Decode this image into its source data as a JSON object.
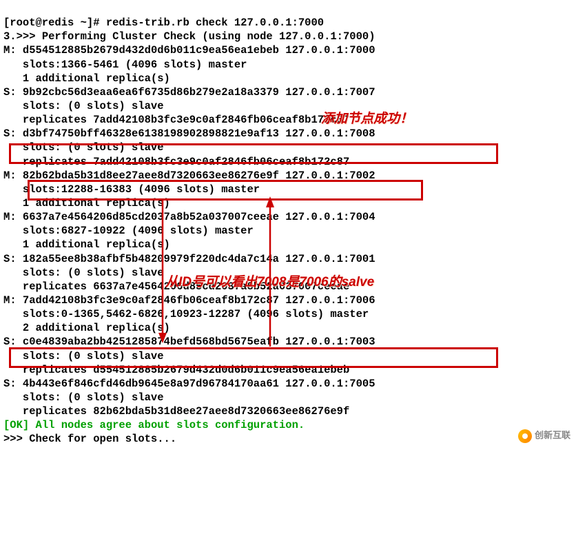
{
  "terminal": {
    "prompt": "[root@redis ~]# ",
    "command": "redis-trib.rb check 127.0.0.1:7000",
    "line_prefix": "3.",
    "header": ">>> Performing Cluster Check (using node 127.0.0.1:7000)",
    "nodes": [
      {
        "role": "M",
        "id": "d554512885b2679d432d0d6b011c9ea56ea1ebeb",
        "addr": "127.0.0.1:7000",
        "slots": "slots:1366-5461 (4096 slots) master",
        "extra": "1 additional replica(s)"
      },
      {
        "role": "S",
        "id": "9b92cbc56d3eaa6ea6f6735d86b279e2a18a3379",
        "addr": "127.0.0.1:7007",
        "slots": "slots: (0 slots) slave",
        "extra": "replicates 7add42108b3fc3e9c0af2846fb06ceaf8b172c87"
      },
      {
        "role": "S",
        "id": "d3bf74750bff46328e6138198902898821e9af13",
        "addr": "127.0.0.1:7008",
        "slots": "slots: (0 slots) slave",
        "extra": "replicates 7add42108b3fc3e9c0af2846fb06ceaf8b172c87"
      },
      {
        "role": "M",
        "id": "82b62bda5b31d8ee27aee8d7320663ee86276e9f",
        "addr": "127.0.0.1:7002",
        "slots": "slots:12288-16383 (4096 slots) master",
        "extra": "1 additional replica(s)"
      },
      {
        "role": "M",
        "id": "6637a7e4564206d85cd2037a8b52a037007ceeae",
        "addr": "127.0.0.1:7004",
        "slots": "slots:6827-10922 (4096 slots) master",
        "extra": "1 additional replica(s)"
      },
      {
        "role": "S",
        "id": "182a55ee8b38afbf5b48209979f220dc4da7c14a",
        "addr": "127.0.0.1:7001",
        "slots": "slots: (0 slots) slave",
        "extra": "replicates 6637a7e4564206d85cd2037a8b52a037007ceeae"
      },
      {
        "role": "M",
        "id": "7add42108b3fc3e9c0af2846fb06ceaf8b172c87",
        "addr": "127.0.0.1:7006",
        "slots": "slots:0-1365,5462-6826,10923-12287 (4096 slots) master",
        "extra": "2 additional replica(s)"
      },
      {
        "role": "S",
        "id": "c0e4839aba2bb4251285874befd568bd5675eafb",
        "addr": "127.0.0.1:7003",
        "slots": "slots: (0 slots) slave",
        "extra": "replicates d554512885b2679d432d0d6b011c9ea56ea1ebeb"
      },
      {
        "role": "S",
        "id": "4b443e6f846cfd46db9645e8a97d96784170aa61",
        "addr": "127.0.0.1:7005",
        "slots": "slots: (0 slots) slave",
        "extra": "replicates 82b62bda5b31d8ee27aee8d7320663ee86276e9f"
      }
    ],
    "ok_prefix": "[OK] ",
    "ok_text": "All nodes agree about slots configuration.",
    "check_slots": ">>> Check for open slots..."
  },
  "annotations": {
    "ann1": "添加节点成功！",
    "ann2_pre": "从ID号可以看出",
    "ann2_num1": "7008",
    "ann2_mid": "是",
    "ann2_num2": "7006",
    "ann2_post": "的salve"
  },
  "watermark": {
    "text": "创新互联"
  }
}
